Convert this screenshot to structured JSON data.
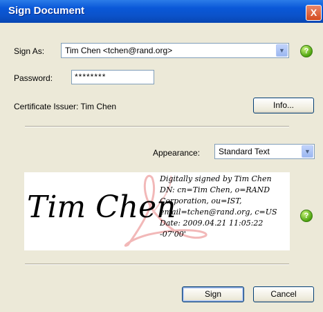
{
  "window": {
    "title": "Sign Document",
    "close_glyph": "X"
  },
  "form": {
    "sign_as_label": "Sign As:",
    "sign_as_value": "Tim Chen <tchen@rand.org>",
    "password_label": "Password:",
    "password_value": "********",
    "issuer_label": "Certificate Issuer: Tim Chen",
    "info_button": "Info...",
    "appearance_label": "Appearance:",
    "appearance_value": "Standard Text",
    "help_glyph": "?"
  },
  "signature_preview": {
    "name": "Tim Chen",
    "lines": [
      "Digitally signed by Tim Chen",
      "DN: cn=Tim Chen, o=RAND",
      "Corporation, ou=IST,",
      "email=tchen@rand.org, c=US",
      "Date: 2009.04.21 11:05:22",
      "-07'00'"
    ]
  },
  "buttons": {
    "sign": "Sign",
    "cancel": "Cancel"
  },
  "colors": {
    "titlebar": "#0a58d8",
    "dialog_bg": "#ece9d8",
    "help_green": "#4ea40f",
    "close_red": "#d34a1f",
    "watermark": "#f2b8b8"
  },
  "icons": {
    "help": "help-icon",
    "close": "close-icon",
    "dropdown": "chevron-down-icon",
    "watermark": "adobe-logo-watermark"
  }
}
